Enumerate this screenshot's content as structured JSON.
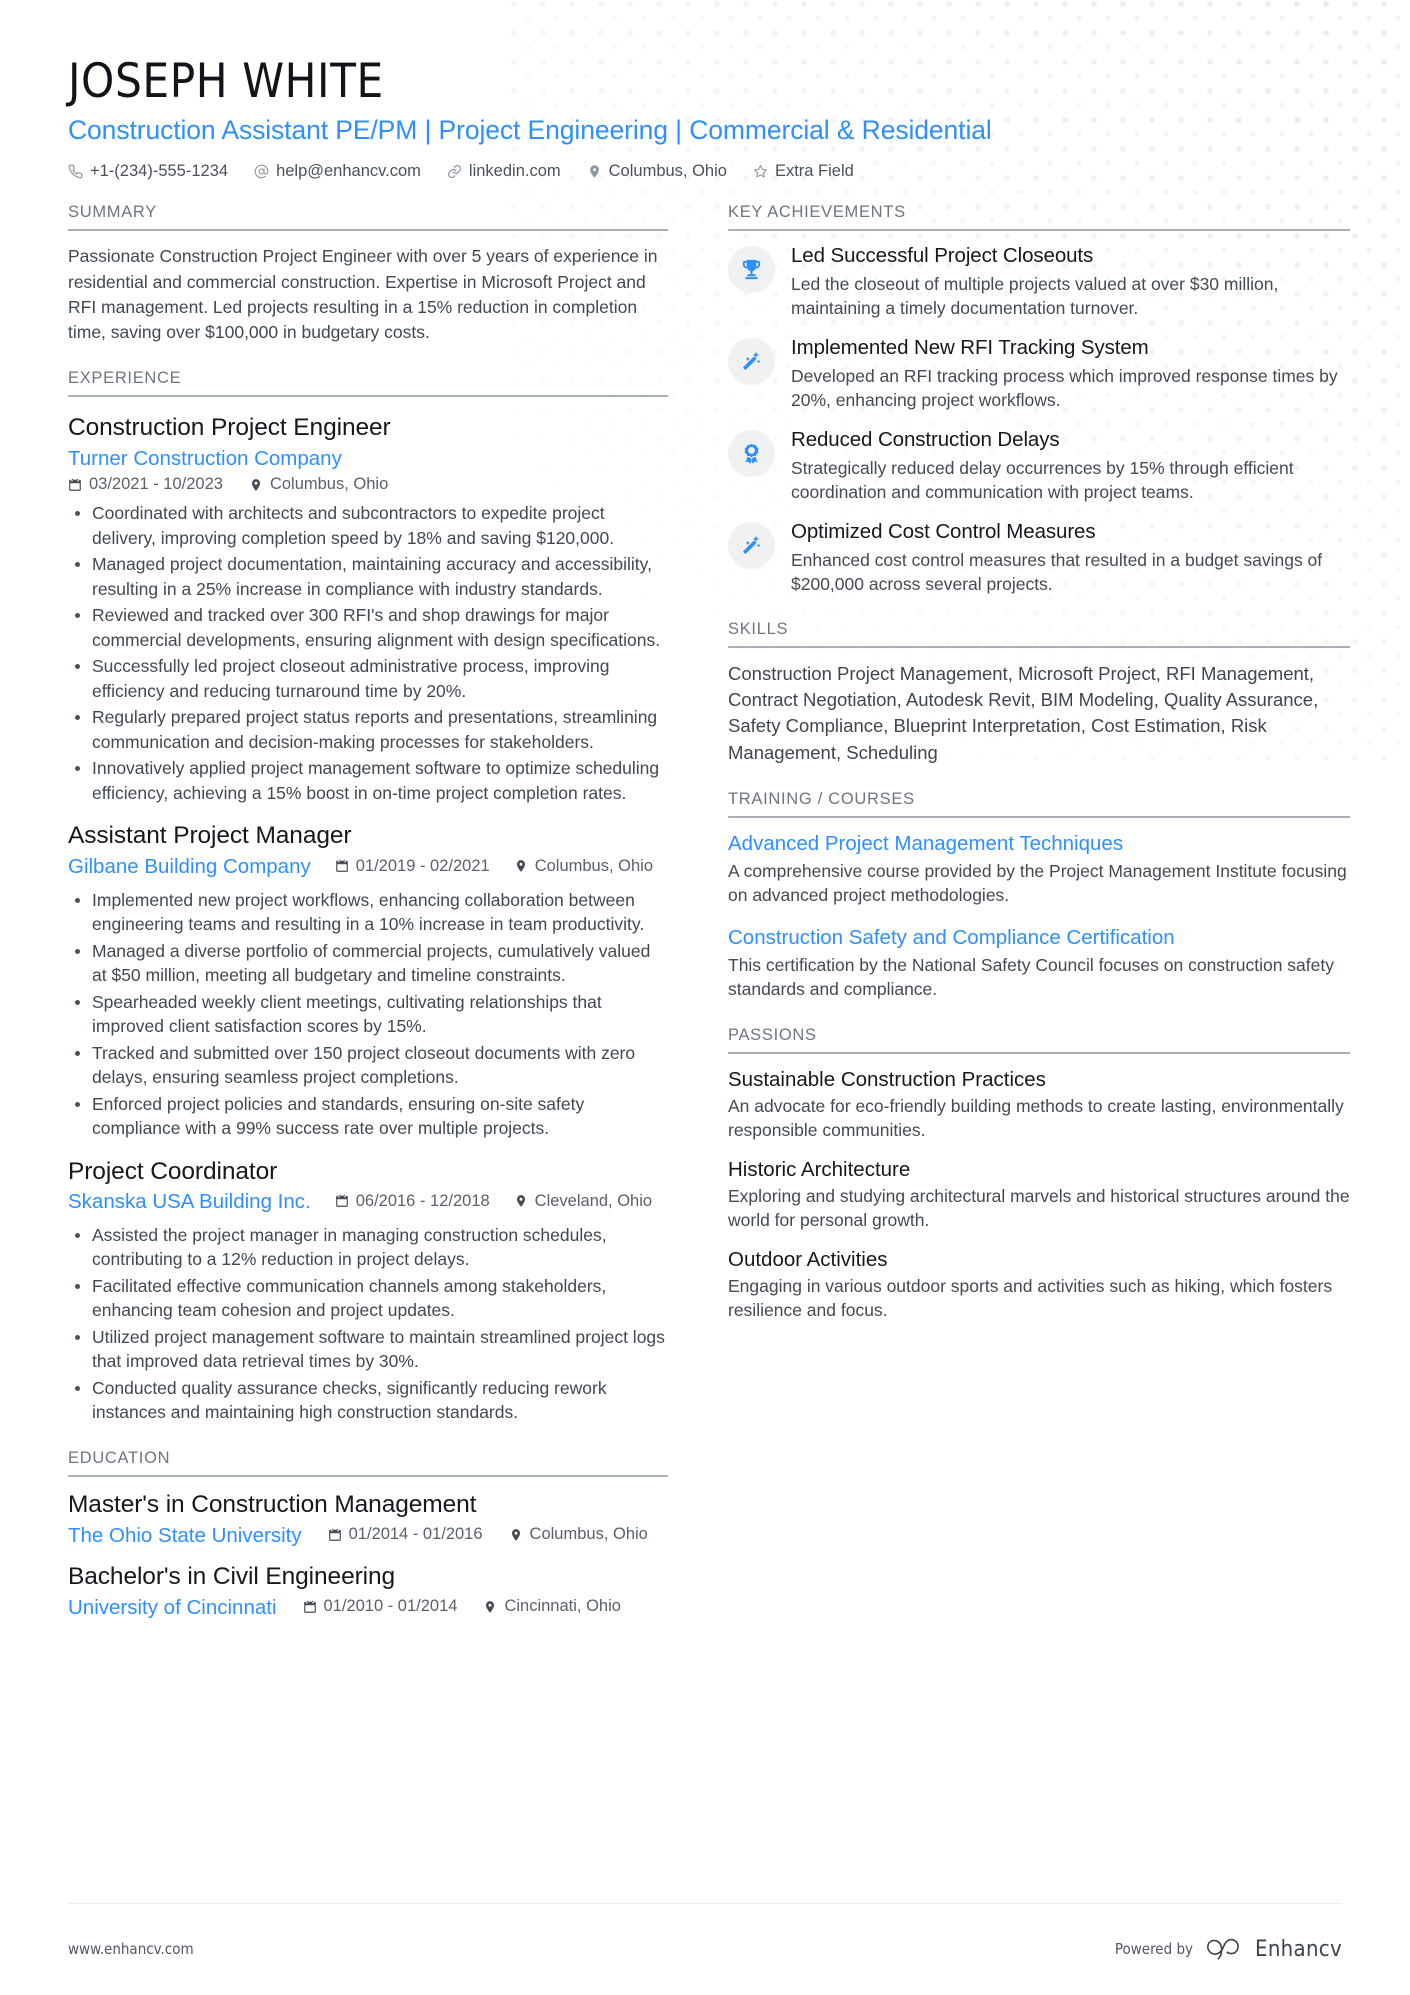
{
  "header": {
    "name": "JOSEPH WHITE",
    "headline": "Construction Assistant PE/PM | Project Engineering | Commercial & Residential",
    "contacts": [
      {
        "icon": "phone-icon",
        "text": "+1-(234)-555-1234"
      },
      {
        "icon": "email-icon",
        "text": "help@enhancv.com"
      },
      {
        "icon": "link-icon",
        "text": "linkedin.com"
      },
      {
        "icon": "location-pin-icon",
        "text": "Columbus, Ohio"
      },
      {
        "icon": "star-icon",
        "text": "Extra Field"
      }
    ]
  },
  "summary": {
    "heading": "SUMMARY",
    "text": "Passionate Construction Project Engineer with over 5 years of experience in residential and commercial construction. Expertise in Microsoft Project and RFI management. Led projects resulting in a 15% reduction in completion time, saving over $100,000 in budgetary costs."
  },
  "experience": {
    "heading": "EXPERIENCE",
    "jobs": [
      {
        "title": "Construction Project Engineer",
        "company": "Turner Construction Company",
        "dates": "03/2021 - 10/2023",
        "location": "Columbus, Ohio",
        "stacked": true,
        "bullets": [
          "Coordinated with architects and subcontractors to expedite project delivery, improving completion speed by 18% and saving $120,000.",
          "Managed project documentation, maintaining accuracy and accessibility, resulting in a 25% increase in compliance with industry standards.",
          "Reviewed and tracked over 300 RFI's and shop drawings for major commercial developments, ensuring alignment with design specifications.",
          "Successfully led project closeout administrative process, improving efficiency and reducing turnaround time by 20%.",
          "Regularly prepared project status reports and presentations, streamlining communication and decision-making processes for stakeholders.",
          "Innovatively applied project management software to optimize scheduling efficiency, achieving a 15% boost in on-time project completion rates."
        ]
      },
      {
        "title": "Assistant Project Manager",
        "company": "Gilbane Building Company",
        "dates": "01/2019 - 02/2021",
        "location": "Columbus, Ohio",
        "stacked": false,
        "bullets": [
          "Implemented new project workflows, enhancing collaboration between engineering teams and resulting in a 10% increase in team productivity.",
          "Managed a diverse portfolio of commercial projects, cumulatively valued at $50 million, meeting all budgetary and timeline constraints.",
          "Spearheaded weekly client meetings, cultivating relationships that improved client satisfaction scores by 15%.",
          "Tracked and submitted over 150 project closeout documents with zero delays, ensuring seamless project completions.",
          "Enforced project policies and standards, ensuring on-site safety compliance with a 99% success rate over multiple projects."
        ]
      },
      {
        "title": "Project Coordinator",
        "company": "Skanska USA Building Inc.",
        "dates": "06/2016 - 12/2018",
        "location": "Cleveland, Ohio",
        "stacked": false,
        "bullets": [
          "Assisted the project manager in managing construction schedules, contributing to a 12% reduction in project delays.",
          "Facilitated effective communication channels among stakeholders, enhancing team cohesion and project updates.",
          "Utilized project management software to maintain streamlined project logs that improved data retrieval times by 30%.",
          "Conducted quality assurance checks, significantly reducing rework instances and maintaining high construction standards."
        ]
      }
    ]
  },
  "education": {
    "heading": "EDUCATION",
    "entries": [
      {
        "degree": "Master's in Construction Management",
        "school": "The Ohio State University",
        "dates": "01/2014 - 01/2016",
        "location": "Columbus, Ohio"
      },
      {
        "degree": "Bachelor's in Civil Engineering",
        "school": "University of Cincinnati",
        "dates": "01/2010 - 01/2014",
        "location": "Cincinnati, Ohio"
      }
    ]
  },
  "achievements": {
    "heading": "KEY ACHIEVEMENTS",
    "items": [
      {
        "icon": "trophy-icon",
        "title": "Led Successful Project Closeouts",
        "desc": "Led the closeout of multiple projects valued at over $30 million, maintaining a timely documentation turnover."
      },
      {
        "icon": "magic-wand-icon",
        "title": "Implemented New RFI Tracking System",
        "desc": "Developed an RFI tracking process which improved response times by 20%, enhancing project workflows."
      },
      {
        "icon": "award-ribbon-icon",
        "title": "Reduced Construction Delays",
        "desc": "Strategically reduced delay occurrences by 15% through efficient coordination and communication with project teams."
      },
      {
        "icon": "magic-wand-icon",
        "title": "Optimized Cost Control Measures",
        "desc": "Enhanced cost control measures that resulted in a budget savings of $200,000 across several projects."
      }
    ]
  },
  "skills": {
    "heading": "SKILLS",
    "text": "Construction Project Management, Microsoft Project, RFI Management, Contract Negotiation, Autodesk Revit, BIM Modeling, Quality Assurance, Safety Compliance, Blueprint Interpretation, Cost Estimation, Risk Management, Scheduling"
  },
  "training": {
    "heading": "TRAINING / COURSES",
    "courses": [
      {
        "title": "Advanced Project Management Techniques",
        "desc": "A comprehensive course provided by the Project Management Institute focusing on advanced project methodologies."
      },
      {
        "title": "Construction Safety and Compliance Certification",
        "desc": "This certification by the National Safety Council focuses on construction safety standards and compliance."
      }
    ]
  },
  "passions": {
    "heading": "PASSIONS",
    "items": [
      {
        "title": "Sustainable Construction Practices",
        "desc": "An advocate for eco-friendly building methods to create lasting, environmentally responsible communities."
      },
      {
        "title": "Historic Architecture",
        "desc": "Exploring and studying architectural marvels and historical structures around the world for personal growth."
      },
      {
        "title": "Outdoor Activities",
        "desc": "Engaging in various outdoor sports and activities such as hiking, which fosters resilience and focus."
      }
    ]
  },
  "footer": {
    "url": "www.enhancv.com",
    "powered_by": "Powered by",
    "brand": "Enhancv"
  },
  "colors": {
    "accent": "#2f8ffb",
    "heading": "#6d757d",
    "body": "#414950",
    "rule": "#a9b0b6"
  }
}
